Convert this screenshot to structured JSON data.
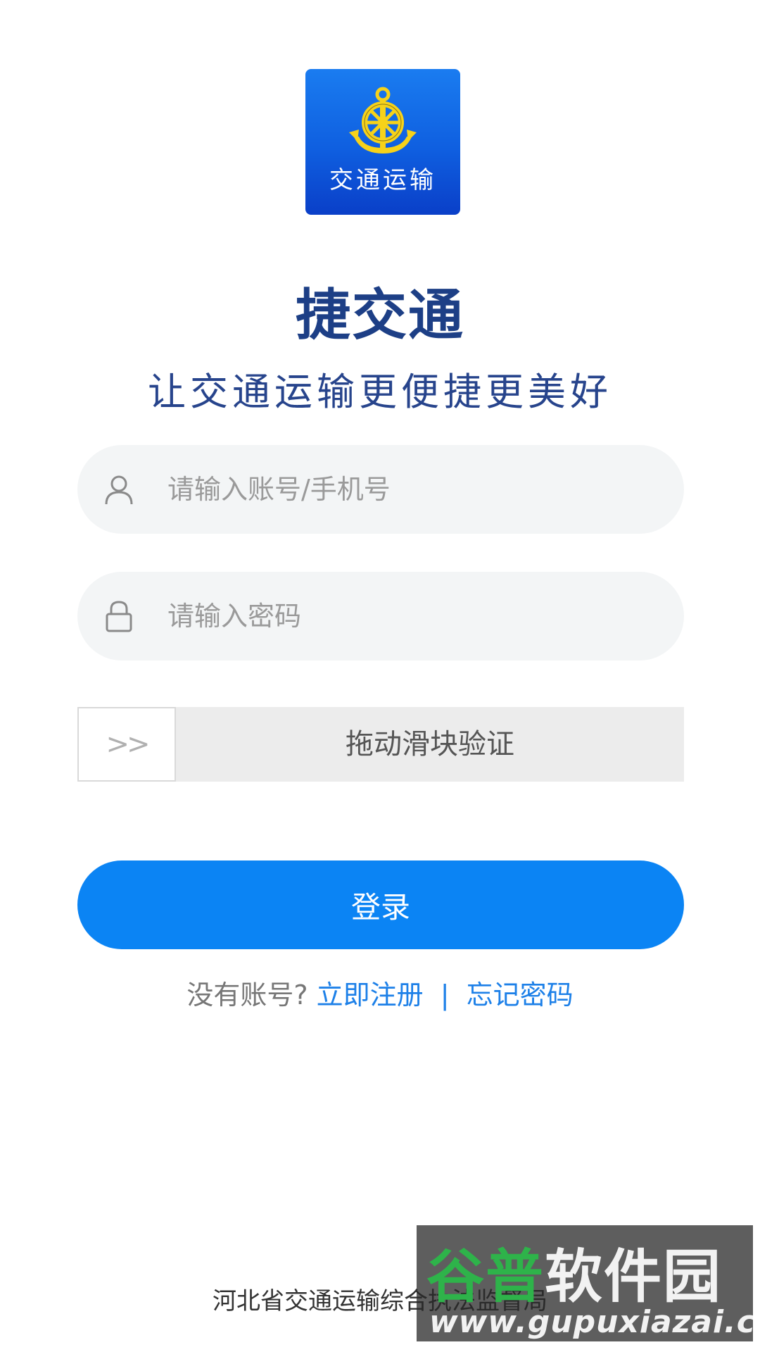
{
  "logo": {
    "text": "交通运输",
    "icon": "anchor-wheel-icon"
  },
  "app": {
    "title": "捷交通",
    "slogan": "让交通运输更便捷更美好"
  },
  "form": {
    "account_placeholder": "请输入账号/手机号",
    "password_placeholder": "请输入密码",
    "slider_handle": ">>",
    "slider_label": "拖动滑块验证",
    "login_label": "登录"
  },
  "links": {
    "prompt": "没有账号?",
    "register": "立即注册",
    "separator": "|",
    "forgot": "忘记密码"
  },
  "footer": {
    "text": "河北省交通运输综合执法监督局"
  },
  "watermark": {
    "top_green": "谷普",
    "top_white": "软件园",
    "url": "www.gupuxiazai.com"
  },
  "colors": {
    "primary": "#0b84f4",
    "title": "#1d3f86",
    "link": "#1d80e8",
    "field_bg": "#f3f5f6"
  }
}
